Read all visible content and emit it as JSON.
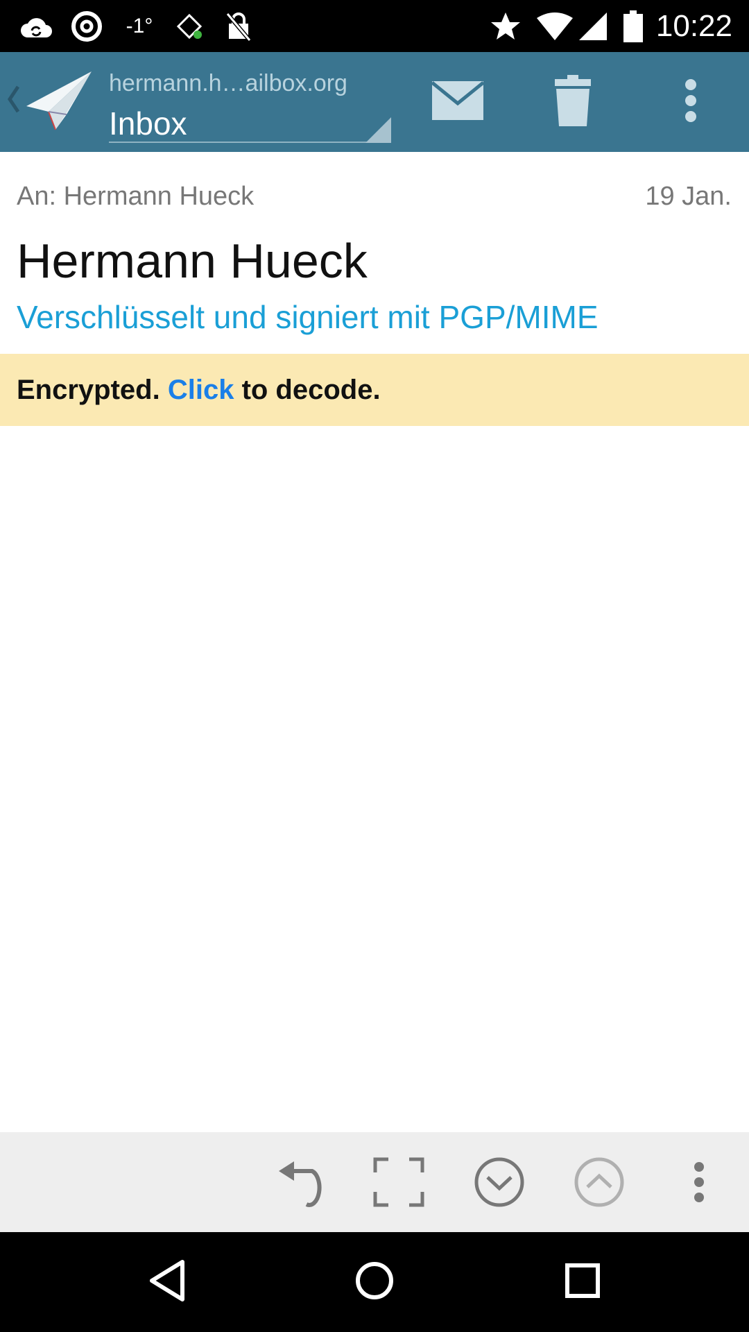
{
  "status_bar": {
    "time": "10:22",
    "temperature": "-1°",
    "icons": [
      "cloud-sync-icon",
      "at-sign-icon",
      "temperature-icon",
      "rain-icon",
      "lock-off-icon",
      "star-icon",
      "wifi-icon",
      "cell-signal-icon",
      "battery-icon"
    ]
  },
  "app_bar": {
    "account": "hermann.h…ailbox.org",
    "folder": "Inbox",
    "actions": [
      "compose-icon",
      "delete-icon",
      "overflow-menu-icon"
    ]
  },
  "message": {
    "to": "An: Hermann Hueck",
    "date": "19 Jan.",
    "subject": "Hermann Hueck",
    "crypto_status": "Verschlüsselt und signiert mit PGP/MIME"
  },
  "banner": {
    "prefix": "Encrypted. ",
    "link": "Click",
    "suffix": " to decode."
  },
  "bottom_toolbar": [
    "reply-icon",
    "fullscreen-icon",
    "next-message-icon",
    "previous-message-icon",
    "overflow-menu-icon"
  ],
  "colors": {
    "app_bar": "#3a7590",
    "accent": "#1a9fd6",
    "banner": "#fbe9b3",
    "link": "#1a7fe8"
  }
}
